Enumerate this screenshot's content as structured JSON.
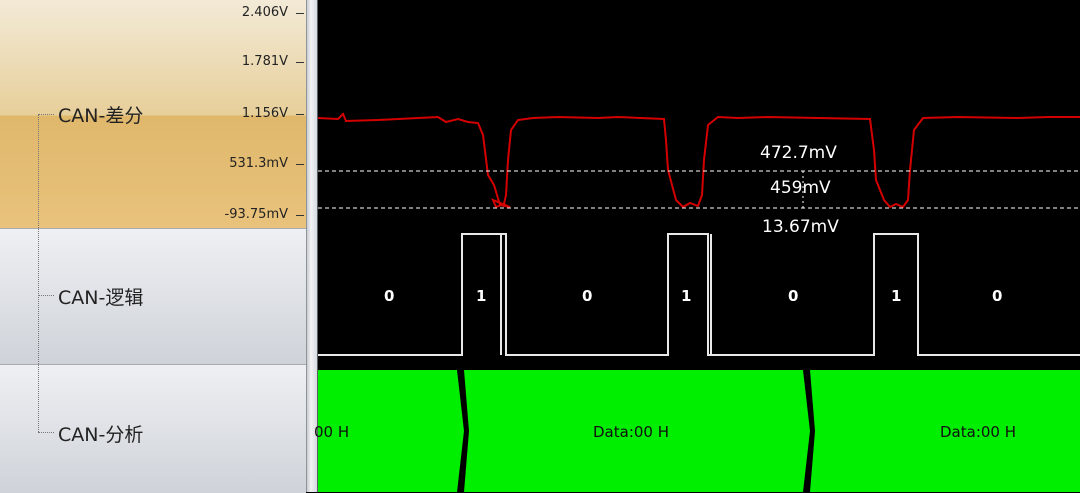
{
  "channels": {
    "diff_label": "CAN-差分",
    "logic_label": "CAN-逻辑",
    "analysis_label": "CAN-分析"
  },
  "y_axis": {
    "ticks": [
      "2.406V",
      "1.781V",
      "1.156V",
      "531.3mV",
      "-93.75mV"
    ]
  },
  "measurements": {
    "upper": "472.7mV",
    "delta": "459mV",
    "lower": "13.67mV"
  },
  "logic_bits": [
    "0",
    "1",
    "0",
    "1",
    "0",
    "1",
    "0"
  ],
  "decode": {
    "segment1": "00 H",
    "segment2": "Data:00 H",
    "segment3": "Data:00 H"
  },
  "colors": {
    "waveform": "#d40000",
    "decode_fill": "#00ee00",
    "logic_trace": "#e8e8e8",
    "cursor_line": "#ffffff"
  }
}
